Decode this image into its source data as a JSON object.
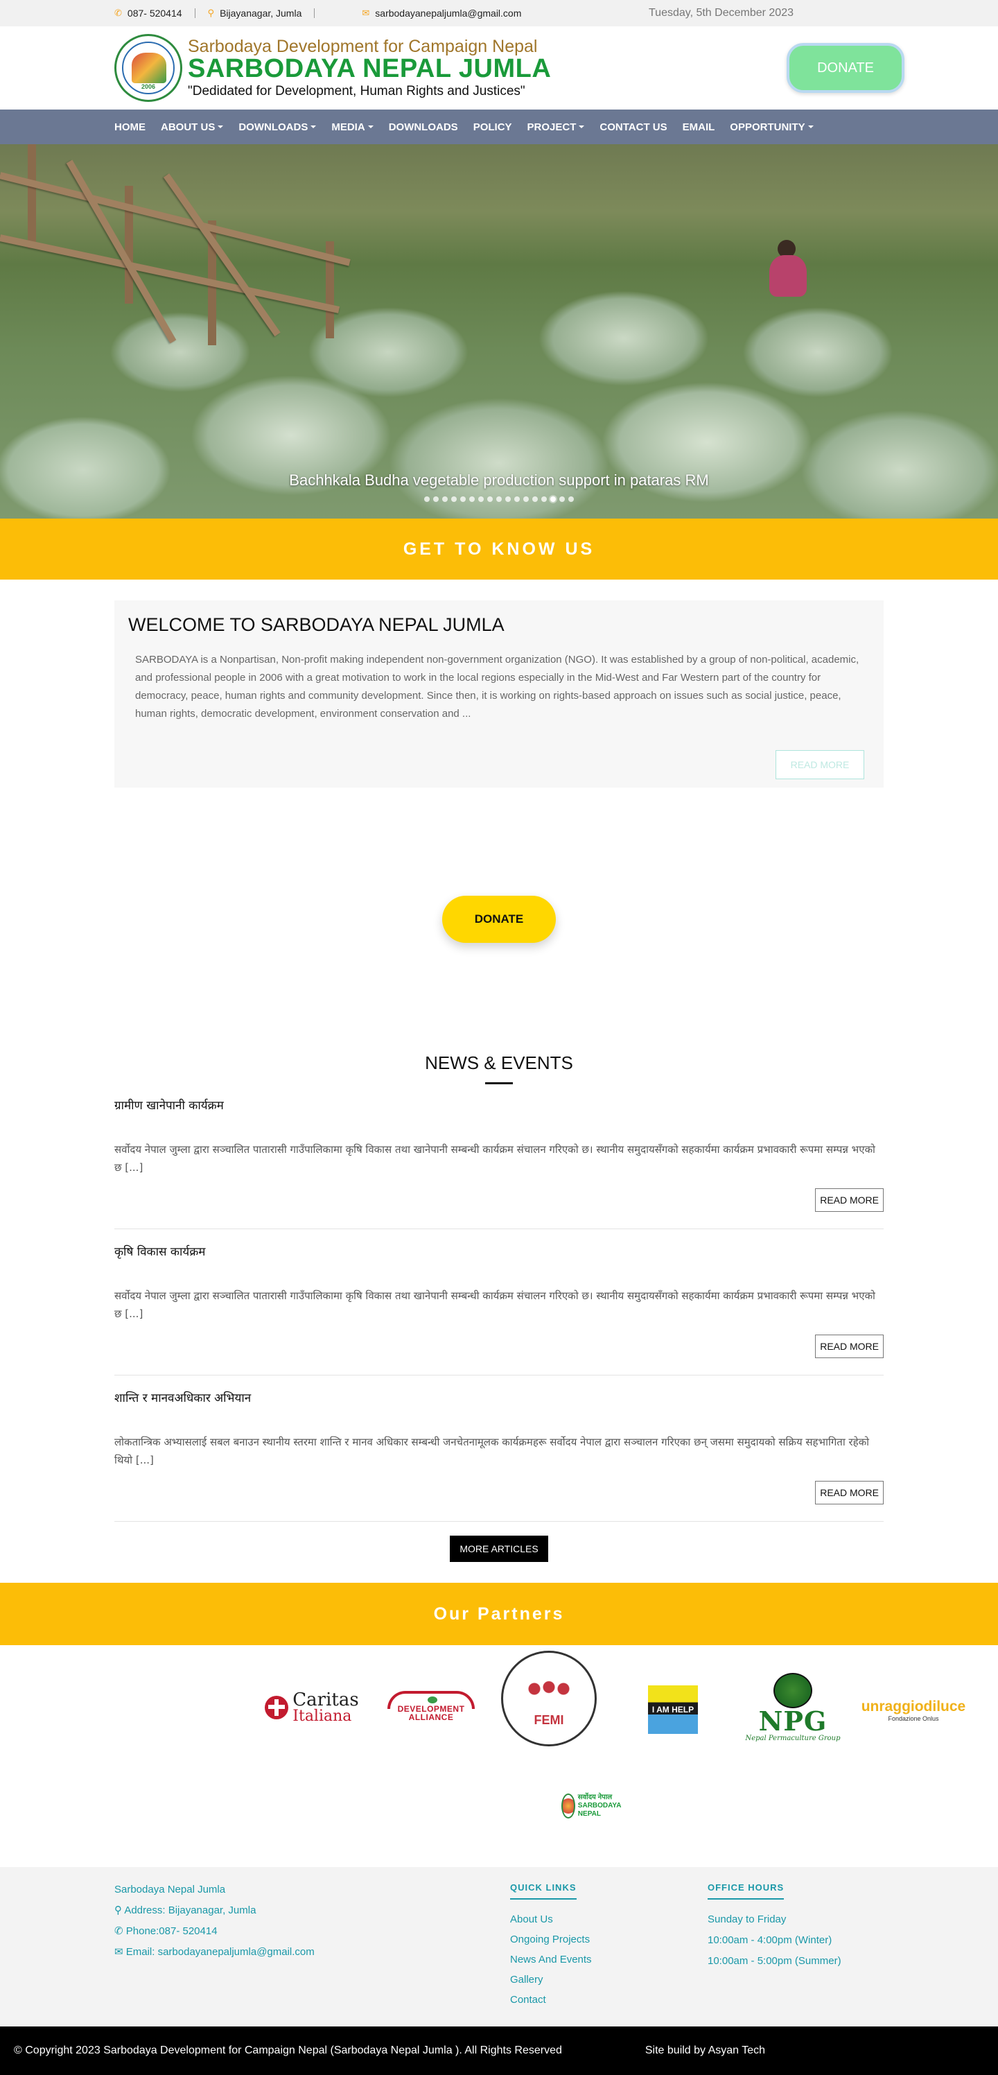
{
  "topbar": {
    "phone": "087- 520414",
    "location": "Bijayanagar, Jumla",
    "email": "sarbodayanepaljumla@gmail.com",
    "date": "Tuesday, 5th December 2023"
  },
  "header": {
    "logo_year": "2006",
    "line1": "Sarbodaya Development for Campaign Nepal",
    "line2": "SARBODAYA NEPAL JUMLA",
    "line3": "\"Dedidated for Development, Human Rights and Justices\"",
    "donate": "DONATE"
  },
  "nav": [
    {
      "label": "HOME",
      "caret": false
    },
    {
      "label": "ABOUT US",
      "caret": true
    },
    {
      "label": "DOWNLOADS",
      "caret": true
    },
    {
      "label": "MEDIA",
      "caret": true
    },
    {
      "label": "DOWNLOADS",
      "caret": false
    },
    {
      "label": "POLICY",
      "caret": false
    },
    {
      "label": "PROJECT",
      "caret": true
    },
    {
      "label": "CONTACT US",
      "caret": false
    },
    {
      "label": "EMAIL",
      "caret": false
    },
    {
      "label": "OPPORTUNITY",
      "caret": true
    }
  ],
  "hero": {
    "caption": "Bachhkala Budha vegetable production support in pataras RM",
    "slide_count": 17,
    "active_slide": 14
  },
  "about": {
    "band": "GET TO KNOW US",
    "title": "WELCOME TO SARBODAYA NEPAL JUMLA",
    "text": "SARBODAYA is a Nonpartisan, Non-profit making independent non-government organization (NGO). It was established by a group of non-political, academic, and professional people in 2006 with a great motivation to work in the local regions especially in the Mid-West and Far Western part of the country for democracy, peace, human rights and community development. Since then, it is working on rights-based approach on issues such as social justice, peace, human rights, democratic development, environment conservation and ...",
    "read_more": "READ MORE"
  },
  "donate_mid": "DONATE",
  "news": {
    "title": "NEWS & EVENTS",
    "items": [
      {
        "title": "ग्रामीण खानेपानी कार्यक्रम",
        "text": "सर्वोदय नेपाल जुम्ला द्वारा सञ्चालित पातारासी गाउँपालिकामा कृषि विकास तथा खानेपानी सम्बन्धी कार्यक्रम संचालन गरिएको छ। स्थानीय समुदायसँगको सहकार्यमा कार्यक्रम प्रभावकारी रूपमा सम्पन्न भएको छ",
        "more": "[...]",
        "read_more": "READ MORE"
      },
      {
        "title": "कृषि विकास कार्यक्रम",
        "text": "सर्वोदय नेपाल जुम्ला द्वारा सञ्चालित पातारासी गाउँपालिकामा कृषि विकास तथा खानेपानी सम्बन्धी कार्यक्रम संचालन गरिएको छ। स्थानीय समुदायसँगको सहकार्यमा कार्यक्रम प्रभावकारी रूपमा सम्पन्न भएको छ",
        "more": "[...]",
        "read_more": "READ MORE"
      },
      {
        "title": "शान्ति र मानवअधिकार अभियान",
        "text": "लोकतान्त्रिक अभ्यासलाई सबल बनाउन स्थानीय स्तरमा शान्ति र मानव अधिकार सम्बन्धी जनचेतनामूलक कार्यक्रमहरू सर्वोदय नेपाल द्वारा सञ्चालन गरिएका छन् जसमा समुदायको सक्रिय सहभागिता रहेको थियो",
        "more": "[...]",
        "read_more": "READ MORE"
      }
    ],
    "more_articles": "MORE ARTICLES"
  },
  "partners": {
    "band": "Our Partners",
    "caritas_1": "Caritas",
    "caritas_2": "Italiana",
    "devall": "DEVELOPMENT ALLIANCE",
    "femi": "FEMI",
    "help": "I AM HELP",
    "npg": "NPG",
    "npg_sub": "Nepal Permaculture Group",
    "unr": "unraggiodiluce",
    "unr_sub": "Fondazione Onlus",
    "sarb": "सर्वोदय नेपाल SARBODAYA NEPAL"
  },
  "footer": {
    "org": "Sarbodaya Nepal Jumla",
    "address": "Address: Bijayanagar, Jumla",
    "phone": "Phone:087- 520414",
    "email": "Email: sarbodayanepaljumla@gmail.com",
    "quick_links_title": "QUICK LINKS",
    "quick_links": [
      "About Us",
      "Ongoing Projects",
      "News And Events",
      "Gallery",
      "Contact"
    ],
    "office_hours_title": "OFFICE HOURS",
    "office_hours": [
      "Sunday to Friday",
      "10:00am - 4:00pm (Winter)",
      "10:00am - 5:00pm (Summer)"
    ]
  },
  "copyright": {
    "text": "© Copyright 2023 Sarbodaya Development for Campaign Nepal (Sarbodaya Nepal Jumla ). All Rights Reserved",
    "built": "Site build by Asyan Tech"
  },
  "colors": {
    "nav": "#6b7893",
    "band": "#fcbd07",
    "donate_top": "#7fe39b",
    "donate_mid": "#ffd700",
    "footer_link": "#1a98a8"
  }
}
